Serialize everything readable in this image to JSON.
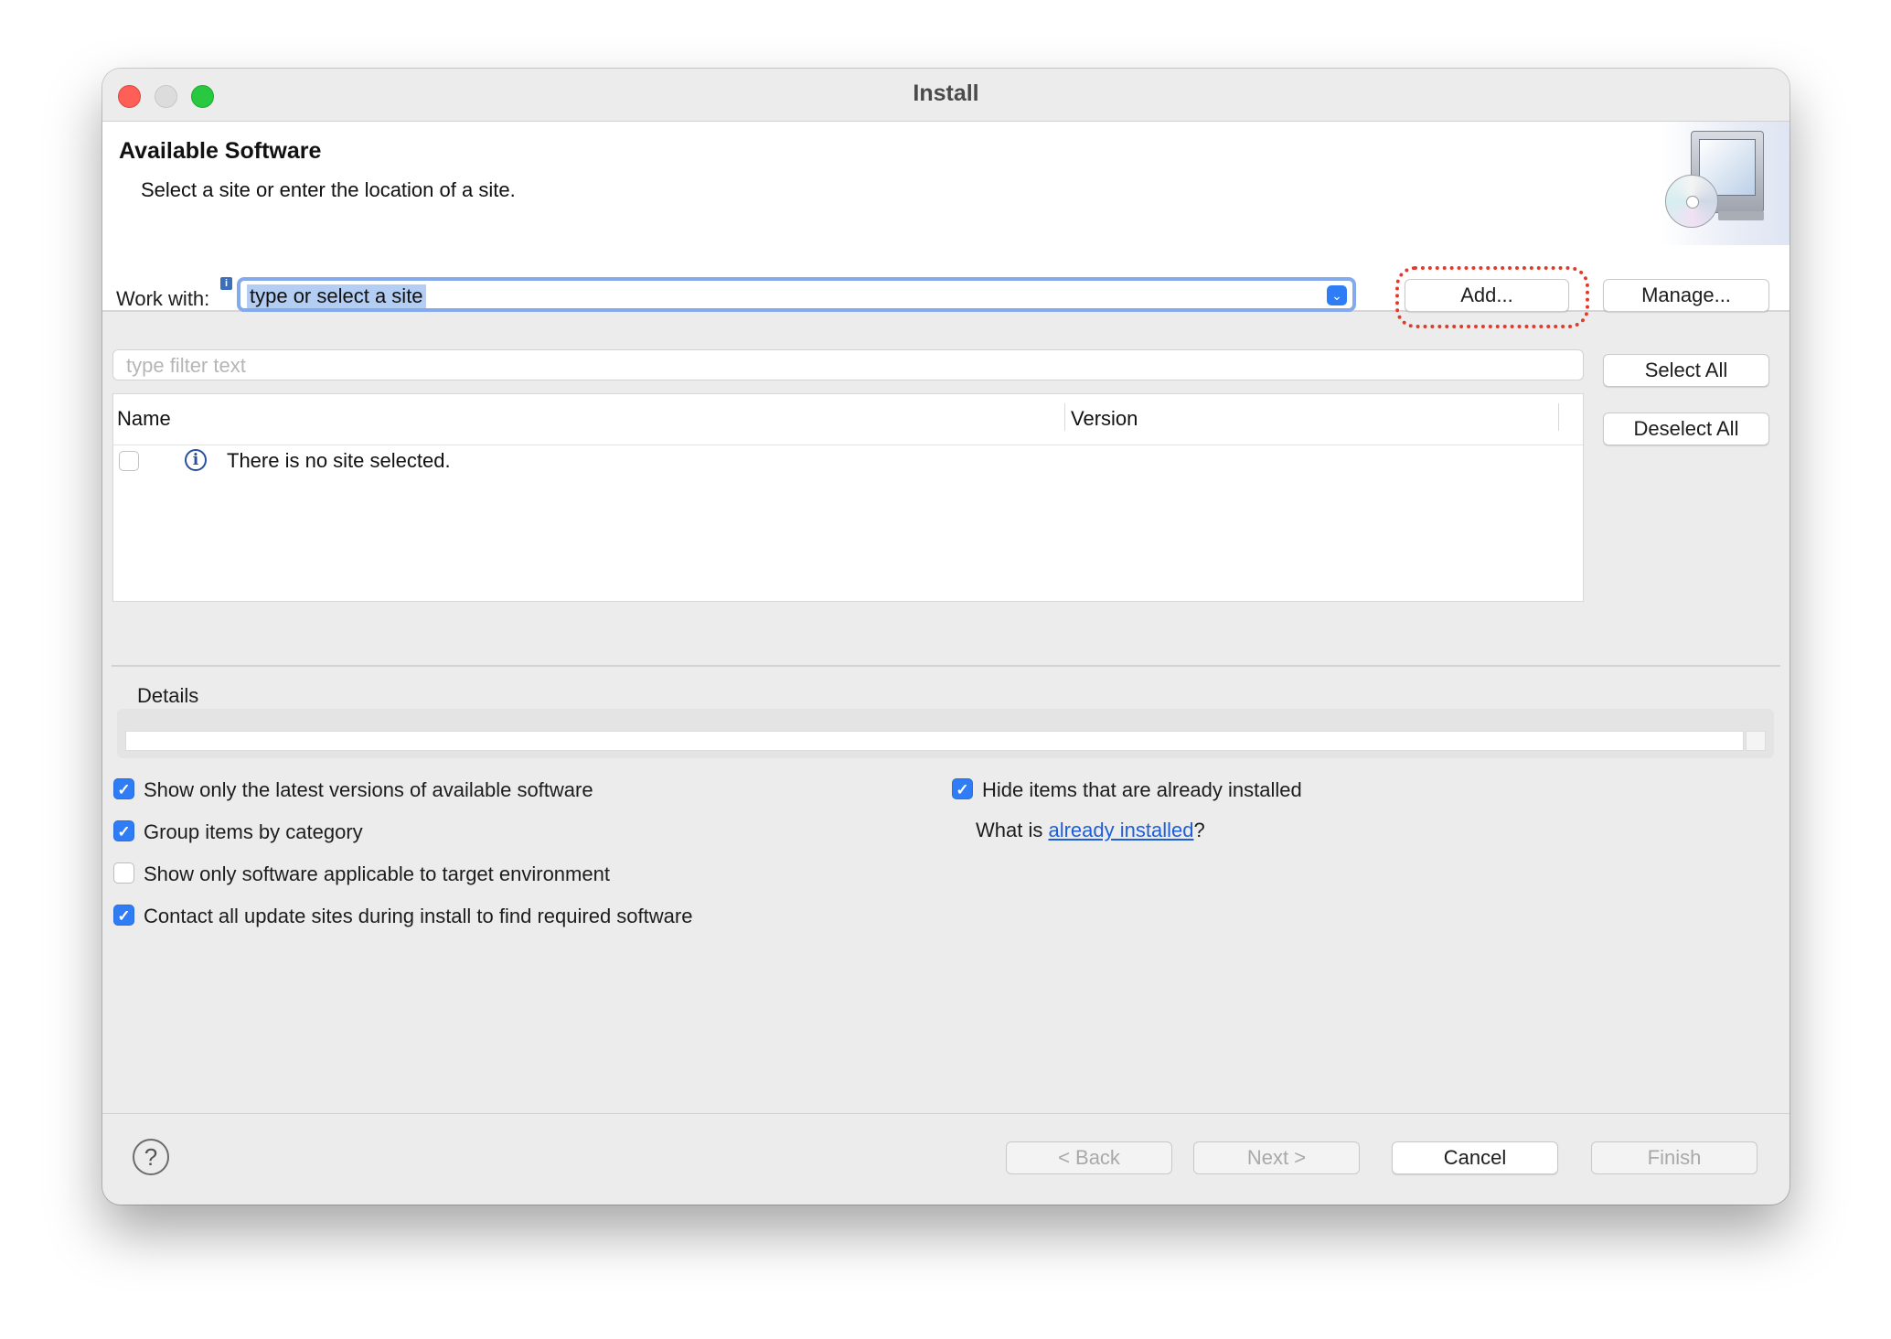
{
  "window": {
    "title": "Install"
  },
  "banner": {
    "title": "Available Software",
    "description": "Select a site or enter the location of a site."
  },
  "work_with": {
    "label": "Work with:",
    "value": "type or select a site",
    "add_label": "Add...",
    "manage_label": "Manage..."
  },
  "filter": {
    "placeholder": "type filter text"
  },
  "table": {
    "columns": [
      "Name",
      "Version"
    ],
    "rows": [
      {
        "text": "There is no site selected.",
        "checked": false
      }
    ]
  },
  "side_buttons": {
    "select_all": "Select All",
    "deselect_all": "Deselect All"
  },
  "details": {
    "label": "Details"
  },
  "options_left": [
    {
      "label": "Show only the latest versions of available software",
      "checked": true
    },
    {
      "label": "Group items by category",
      "checked": true
    },
    {
      "label": "Show only software applicable to target environment",
      "checked": false
    },
    {
      "label": "Contact all update sites during install to find required software",
      "checked": true
    }
  ],
  "options_right": {
    "hide_installed": {
      "label": "Hide items that are already installed",
      "checked": true
    },
    "what_is_prefix": "What is ",
    "what_is_link": "already installed",
    "what_is_suffix": "?"
  },
  "footer": {
    "back": "< Back",
    "next": "Next >",
    "cancel": "Cancel",
    "finish": "Finish"
  },
  "colors": {
    "accent": "#2f7df6",
    "highlight_ring": "#e23a2a",
    "link": "#1f5fd6"
  }
}
